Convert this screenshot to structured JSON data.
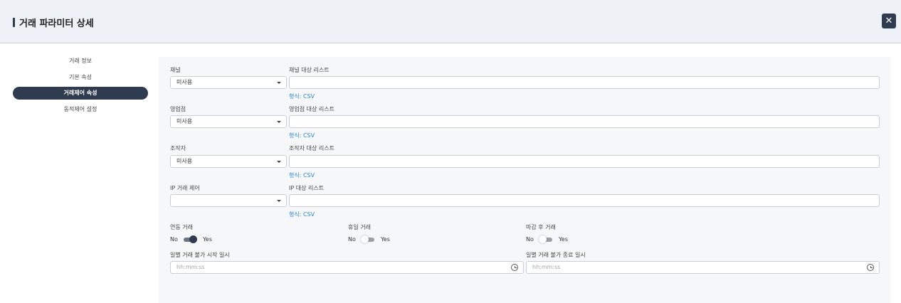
{
  "header": {
    "title": "거래 파라미터 상세",
    "close_icon": "close-icon"
  },
  "sidebar": {
    "items": [
      {
        "label": "거래 정보",
        "active": false
      },
      {
        "label": "기본 속성",
        "active": false
      },
      {
        "label": "거래제어 속성",
        "active": true
      },
      {
        "label": "동적제어 설정",
        "active": false
      }
    ]
  },
  "form": {
    "rows": [
      {
        "left_label": "채널",
        "select_value": "미사용",
        "right_label": "채널 대상 리스트",
        "input_value": "",
        "hint": "형식: CSV"
      },
      {
        "left_label": "영업점",
        "select_value": "미사용",
        "right_label": "영업점 대상 리스트",
        "input_value": "",
        "hint": "형식: CSV"
      },
      {
        "left_label": "조작자",
        "select_value": "미사용",
        "right_label": "조작자 대상 리스트",
        "input_value": "",
        "hint": "형식: CSV"
      },
      {
        "left_label": "IP 거래 제어",
        "select_value": "",
        "right_label": "IP 대상 리스트",
        "input_value": "",
        "hint": "형식: CSV"
      }
    ],
    "toggles": [
      {
        "label": "연동 거래",
        "no": "No",
        "yes": "Yes",
        "on": true
      },
      {
        "label": "휴일 거래",
        "no": "No",
        "yes": "Yes",
        "on": false
      },
      {
        "label": "마감 후 거래",
        "no": "No",
        "yes": "Yes",
        "on": false
      }
    ],
    "times": [
      {
        "label": "일별 거래 불가 시작 일시",
        "placeholder": "hh:mm:ss"
      },
      {
        "label": "일별 거래 불가 종료 일시",
        "placeholder": "hh:mm:ss"
      }
    ]
  },
  "colors": {
    "accent": "#2f3b4e",
    "hint": "#2a85d8",
    "header_bg": "#eef1f5",
    "panel_bg": "#f6f7f8"
  }
}
